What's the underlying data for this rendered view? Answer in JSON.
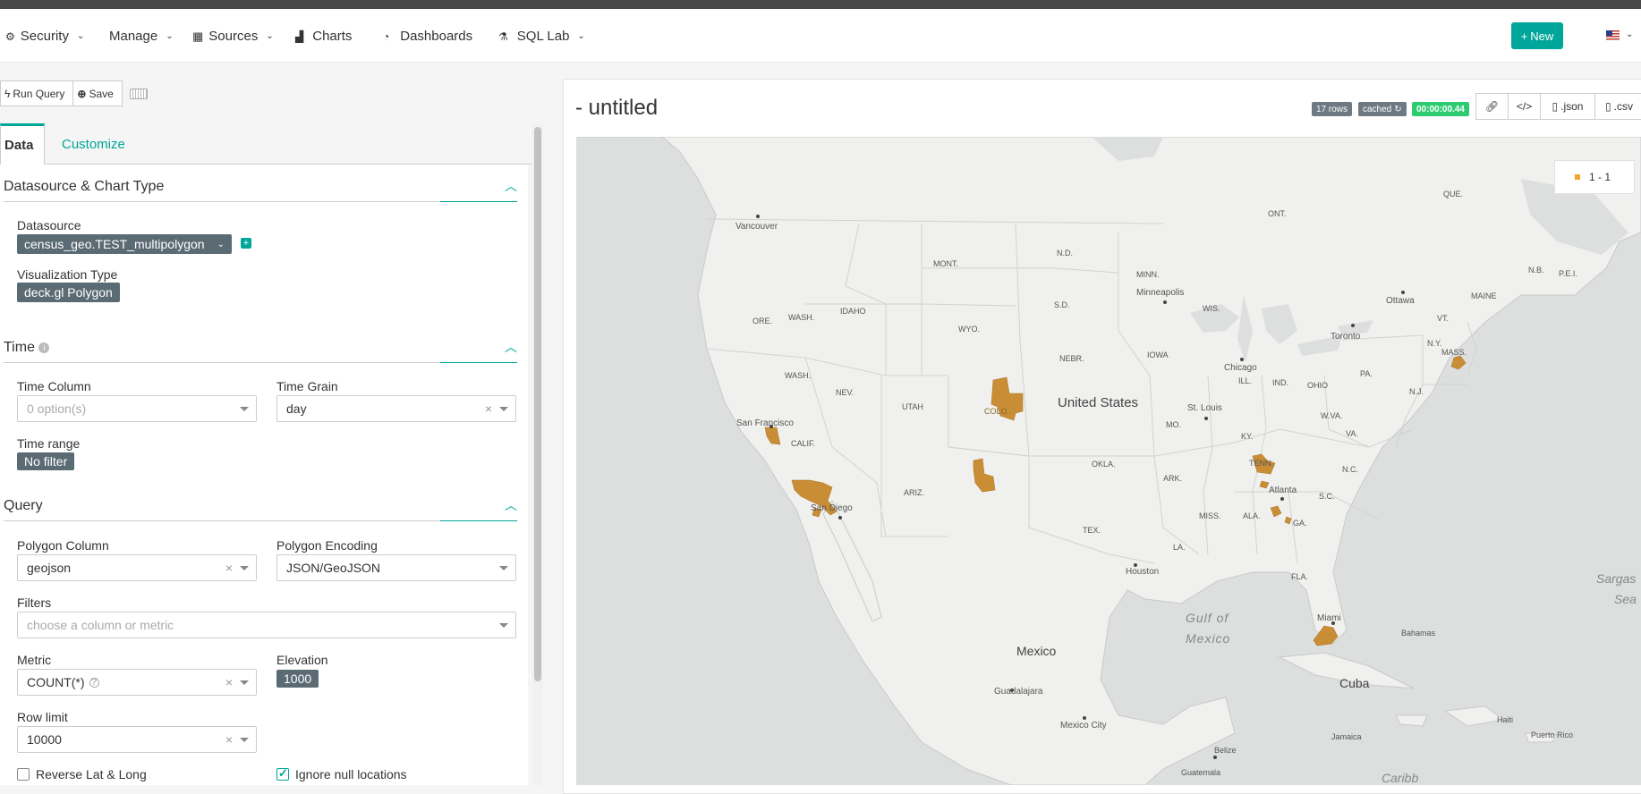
{
  "nav": {
    "security": "Security",
    "manage": "Manage",
    "sources": "Sources",
    "charts": "Charts",
    "dashboards": "Dashboards",
    "sqllab": "SQL Lab",
    "new_button": "New"
  },
  "toolbar": {
    "run_query": "Run Query",
    "save": "Save"
  },
  "tabs": {
    "data": "Data",
    "customize": "Customize"
  },
  "sections": {
    "datasource_chart_type": {
      "title": "Datasource & Chart Type",
      "datasource_label": "Datasource",
      "datasource_value": "census_geo.TEST_multipolygon",
      "viz_type_label": "Visualization Type",
      "viz_type_value": "deck.gl Polygon"
    },
    "time": {
      "title": "Time",
      "time_column_label": "Time Column",
      "time_column_placeholder": "0 option(s)",
      "time_grain_label": "Time Grain",
      "time_grain_value": "day",
      "time_range_label": "Time range",
      "time_range_value": "No filter"
    },
    "query": {
      "title": "Query",
      "polygon_column_label": "Polygon Column",
      "polygon_column_value": "geojson",
      "polygon_encoding_label": "Polygon Encoding",
      "polygon_encoding_value": "JSON/GeoJSON",
      "filters_label": "Filters",
      "filters_placeholder": "choose a column or metric",
      "metric_label": "Metric",
      "metric_value": "COUNT(*)",
      "elevation_label": "Elevation",
      "elevation_value": "1000",
      "row_limit_label": "Row limit",
      "row_limit_value": "10000",
      "reverse_latlong_label": "Reverse Lat & Long",
      "reverse_latlong_checked": false,
      "ignore_null_label": "Ignore null locations",
      "ignore_null_checked": true
    }
  },
  "chart": {
    "title": "- untitled",
    "rows_badge": "17 rows",
    "cached_badge": "cached",
    "timer_badge": "00:00:00.44",
    "json_button": ".json",
    "csv_button": ".csv",
    "legend_label": "1 - 1",
    "legend_color": "#f4a62a",
    "polygon_color": "#c98d36"
  },
  "map_labels": {
    "countries": [
      "United States",
      "Mexico",
      "Cuba"
    ],
    "seas": [
      "Gulf of",
      "Mexico",
      "Sargas",
      "Sea",
      "Caribb"
    ],
    "states": [
      "WASH.",
      "ORE.",
      "IDAHO",
      "MONT.",
      "WYO.",
      "NEV.",
      "CALIF.",
      "UTAH",
      "ARIZ.",
      "N.D.",
      "S.D.",
      "NEBR.",
      "OKLA.",
      "TEX.",
      "MINN.",
      "IOWA",
      "ILL.",
      "IND.",
      "OHIO",
      "WIS.",
      "MO.",
      "ARK.",
      "KY.",
      "TENN.",
      "MISS.",
      "ALA.",
      "GA.",
      "LA.",
      "FLA.",
      "S.C.",
      "N.C.",
      "VA.",
      "W.VA.",
      "PA.",
      "N.Y.",
      "VT.",
      "MAINE",
      "MASS.",
      "N.J.",
      "ONT.",
      "QUE.",
      "N.B.",
      "P.E.I.",
      "COLO."
    ],
    "cities": [
      "Vancouver",
      "San Francisco",
      "San Diego",
      "Minneapolis",
      "Chicago",
      "St. Louis",
      "Toronto",
      "Ottawa",
      "Atlanta",
      "Houston",
      "Miami",
      "Guadalajara",
      "Mexico City",
      "Bahamas",
      "Haiti",
      "Jamaica",
      "Puerto Rico",
      "Belize",
      "Guatemala"
    ]
  }
}
